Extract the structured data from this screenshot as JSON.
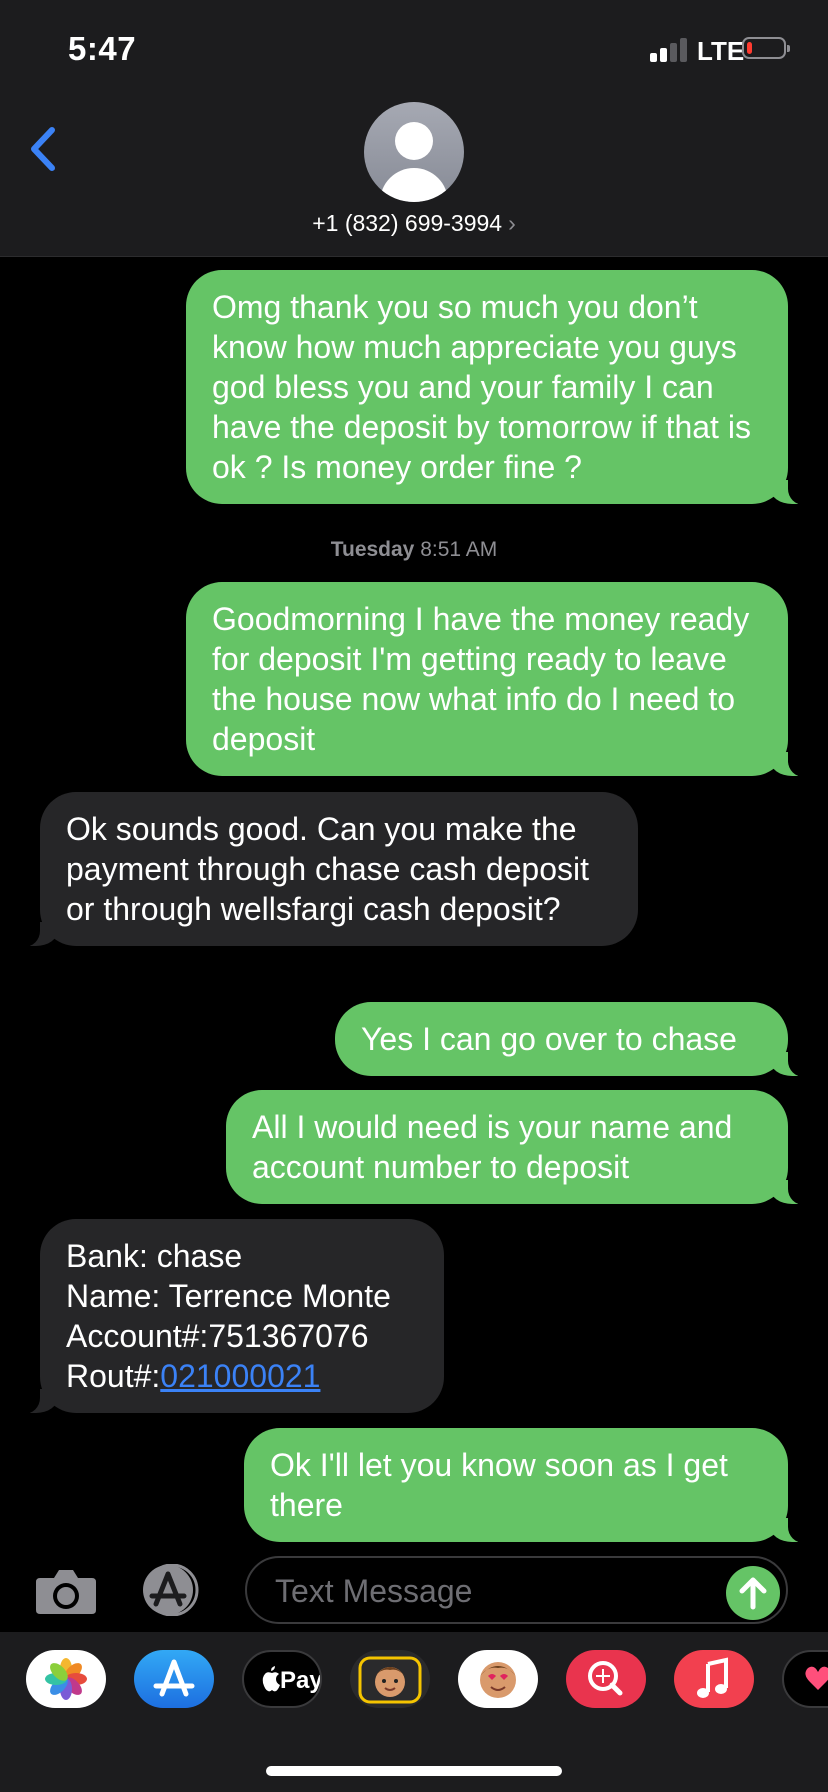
{
  "status_bar": {
    "time": "5:47",
    "network": "LTE",
    "battery_level": 0.1,
    "signal_bars": 2
  },
  "header": {
    "contact": "+1 (832) 699-3994",
    "back_icon": "chevron-left-icon",
    "chevron": "›"
  },
  "timestamp": {
    "day": "Tuesday",
    "time": "8:51 AM"
  },
  "messages": [
    {
      "from": "me",
      "text": "Omg thank you so much you don’t know how much appreciate you guys god bless you and your family I can have the deposit by tomorrow if that is ok ? Is money order fine ?"
    },
    {
      "from": "me",
      "text": "Goodmorning I have the money ready for deposit I'm getting ready to leave the house now what info do I need to deposit"
    },
    {
      "from": "them",
      "text": "Ok sounds good. Can you make the payment through chase cash deposit or through wellsfargi cash deposit?"
    },
    {
      "from": "me",
      "text": "Yes I can go over to chase"
    },
    {
      "from": "me",
      "text": "All I would need is your name and account number to deposit"
    },
    {
      "from": "them",
      "lines": [
        "Bank: chase",
        "Name: Terrence Monte",
        "Account#:751367076"
      ],
      "rout_label": "Rout#:",
      "rout_link": "021000021"
    },
    {
      "from": "me",
      "text": "Ok I'll let you know soon as I get there"
    }
  ],
  "input": {
    "placeholder": "Text Message"
  },
  "colors": {
    "sent_bubble": "#65c466",
    "received_bubble": "#262628",
    "link": "#3b82f6",
    "header_bg": "#1c1c1e"
  },
  "app_drawer": {
    "apps": [
      "photos-icon",
      "app-store-icon",
      "apple-pay-icon",
      "memoji-icon",
      "animoji-icon",
      "web-images-icon",
      "music-icon",
      "digital-touch-icon"
    ],
    "apple_pay_label": "Pay"
  }
}
